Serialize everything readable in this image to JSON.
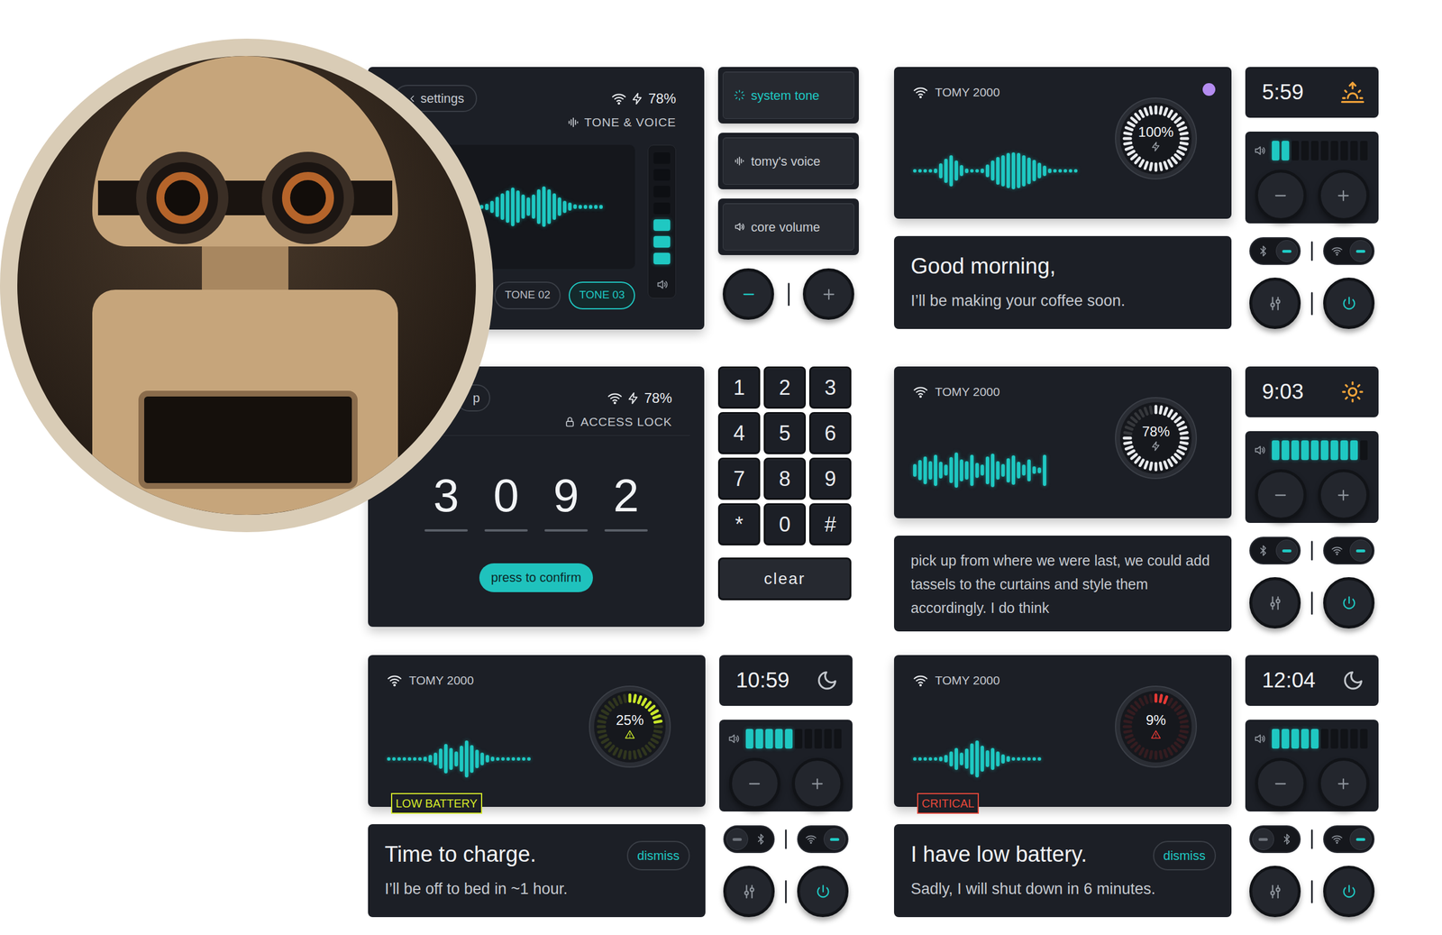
{
  "tone_panel": {
    "back": "settings",
    "battery": "78%",
    "section": "TONE & VOICE",
    "wave": [
      0.1,
      0.1,
      0.15,
      0.3,
      0.5,
      0.65,
      0.8,
      0.95,
      0.8,
      0.6,
      0.45,
      0.6,
      0.85,
      1,
      0.85,
      0.65,
      0.45,
      0.3,
      0.2,
      0.12,
      0.1,
      0.1,
      0.1,
      0.1,
      0.1
    ],
    "volume": {
      "level": 0.43
    },
    "tones": [
      {
        "label": "TONE 02",
        "selected": false
      },
      {
        "label": "TONE 03",
        "selected": true
      }
    ]
  },
  "tone_menu": {
    "items": [
      {
        "label": "system tone",
        "kind": "tone",
        "selected": true
      },
      {
        "label": "tomy's voice",
        "kind": "voice",
        "selected": false
      },
      {
        "label": "core volume",
        "kind": "volume",
        "selected": false
      }
    ],
    "minus_active": true
  },
  "lock_panel": {
    "back": "p",
    "battery": "78%",
    "section": "ACCESS LOCK",
    "code": [
      "3",
      "0",
      "9",
      "2"
    ],
    "confirm": "press to confirm"
  },
  "keypad": {
    "keys": [
      "1",
      "2",
      "3",
      "4",
      "5",
      "6",
      "7",
      "8",
      "9",
      "*",
      "0",
      "#"
    ],
    "clear": "clear"
  },
  "devices": [
    {
      "name": "TOMY 2000",
      "battery": "100%",
      "level": 1,
      "charging": true,
      "ring_color": "#e8eaed",
      "dot": true,
      "wave": [
        0.1,
        0.1,
        0.1,
        0.1,
        0.12,
        0.4,
        0.65,
        0.85,
        0.55,
        0.3,
        0.12,
        0.1,
        0.1,
        0.12,
        0.35,
        0.55,
        0.75,
        0.85,
        0.95,
        1,
        0.95,
        0.85,
        0.72,
        0.58,
        0.42,
        0.28,
        0.12,
        0.1,
        0.1,
        0.1,
        0.1,
        0.1
      ],
      "message": {
        "kind": "notice",
        "title": "Good morning,",
        "body": "I’ll be making your coffee soon."
      },
      "time": "5:59",
      "time_kind": "sunrise",
      "volume": {
        "level": 0.2
      },
      "bluetooth": {
        "on": true
      },
      "wifi": {
        "on": true
      }
    },
    {
      "name": "TOMY 2000",
      "battery": "78%",
      "level": 0.78,
      "charging": true,
      "ring_color": "#e8eaed",
      "dot": false,
      "wave": [
        0.35,
        0.55,
        0.75,
        0.5,
        0.85,
        0.45,
        0.3,
        0.7,
        0.95,
        0.6,
        0.5,
        0.85,
        0.4,
        0.3,
        0.75,
        0.9,
        0.5,
        0.35,
        0.65,
        0.8,
        0.45,
        0.3,
        0.6,
        0.2,
        0.15,
        0.85
      ],
      "message": {
        "kind": "transcript",
        "body": "pick up from where we were last, we could add tassels to the curtains and style them accordingly. I do think"
      },
      "time": "9:03",
      "time_kind": "sun",
      "volume": {
        "level": 0.9
      },
      "bluetooth": {
        "on": true
      },
      "wifi": {
        "on": true
      }
    },
    {
      "name": "TOMY 2000",
      "battery": "25%",
      "level": 0.25,
      "charging": false,
      "ring_color": "#c8e62a",
      "dot": false,
      "badge": {
        "label": "LOW BATTERY",
        "color": "#d4e82a"
      },
      "wave": [
        0.1,
        0.1,
        0.1,
        0.1,
        0.1,
        0.1,
        0.1,
        0.12,
        0.2,
        0.35,
        0.55,
        0.8,
        0.6,
        0.4,
        0.7,
        1,
        0.75,
        0.5,
        0.35,
        0.2,
        0.12,
        0.1,
        0.1,
        0.1,
        0.1,
        0.1,
        0.1,
        0.1
      ],
      "message": {
        "kind": "notice",
        "title": "Time to charge.",
        "body": "I’ll be off to bed in ~1 hour.",
        "dismiss": "dismiss"
      },
      "time": "10:59",
      "time_kind": "moon",
      "volume": {
        "level": 0.5
      },
      "bluetooth": {
        "on": false
      },
      "wifi": {
        "on": true
      }
    },
    {
      "name": "TOMY 2000",
      "battery": "9%",
      "level": 0.09,
      "charging": false,
      "ring_color": "#e53935",
      "dot": false,
      "badge": {
        "label": "CRITICAL",
        "color": "#e5483a"
      },
      "wave": [
        0.1,
        0.1,
        0.1,
        0.1,
        0.1,
        0.12,
        0.2,
        0.4,
        0.6,
        0.35,
        0.55,
        0.85,
        1,
        0.7,
        0.45,
        0.6,
        0.4,
        0.25,
        0.15,
        0.1,
        0.1,
        0.1,
        0.1,
        0.1,
        0.1
      ],
      "message": {
        "kind": "notice",
        "title": "I have low battery.",
        "body": "Sadly, I will shut down in 6 minutes.",
        "dismiss": "dismiss"
      },
      "time": "12:04",
      "time_kind": "moon",
      "volume": {
        "level": 0.5
      },
      "bluetooth": {
        "on": false
      },
      "wifi": {
        "on": true
      }
    }
  ]
}
